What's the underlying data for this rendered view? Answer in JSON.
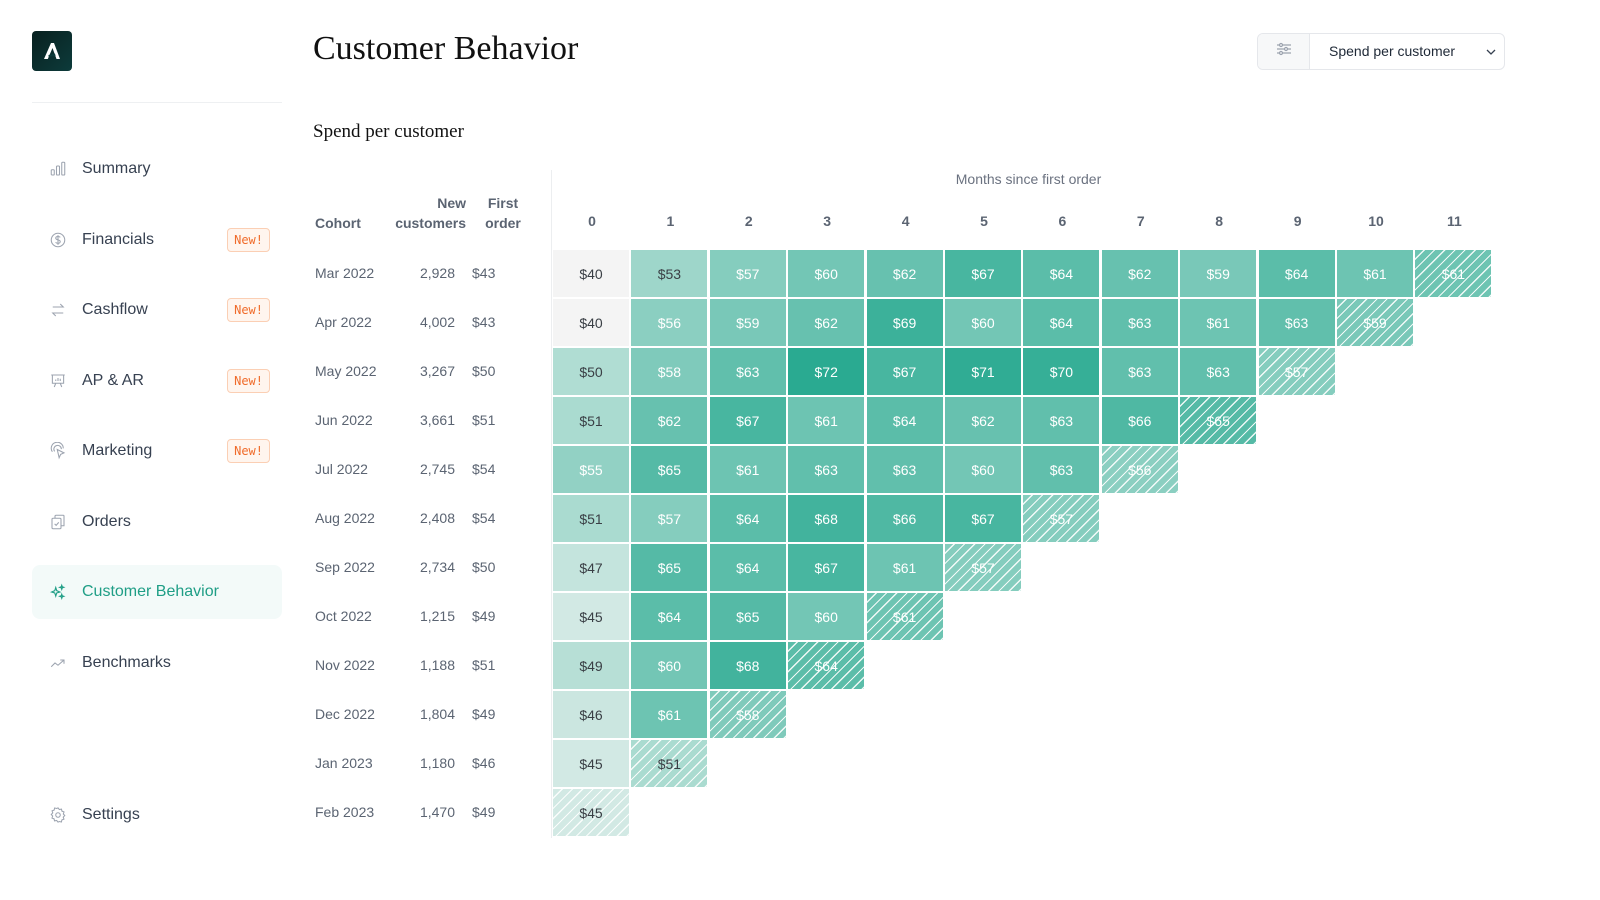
{
  "app": {
    "logo_letter": "A"
  },
  "sidebar": {
    "items": [
      {
        "label": "Summary",
        "icon": "bar-chart-icon",
        "badge": null,
        "active": false
      },
      {
        "label": "Financials",
        "icon": "dollar-circle-icon",
        "badge": "New!",
        "active": false
      },
      {
        "label": "Cashflow",
        "icon": "arrows-exchange-icon",
        "badge": "New!",
        "active": false
      },
      {
        "label": "AP & AR",
        "icon": "presentation-chart-icon",
        "badge": "New!",
        "active": false
      },
      {
        "label": "Marketing",
        "icon": "cursor-click-icon",
        "badge": "New!",
        "active": false
      },
      {
        "label": "Orders",
        "icon": "clipboard-check-icon",
        "badge": null,
        "active": false
      },
      {
        "label": "Customer Behavior",
        "icon": "sparkles-icon",
        "badge": null,
        "active": true
      },
      {
        "label": "Benchmarks",
        "icon": "trending-up-icon",
        "badge": null,
        "active": false
      }
    ],
    "settings": {
      "label": "Settings",
      "icon": "gear-icon"
    }
  },
  "header": {
    "title": "Customer Behavior",
    "metric_select": {
      "value": "Spend per customer",
      "icon": "sliders-icon"
    }
  },
  "colors": {
    "accent": "#1f9e86",
    "badge_text": "#f06b2a",
    "badge_bg": "#fff5ee"
  },
  "chart_data": {
    "type": "heatmap",
    "title": "Spend per customer",
    "xlabel": "Months since first order",
    "row_headers": {
      "cohort": "Cohort",
      "new_customers": "New customers",
      "first_order": "First order"
    },
    "columns": [
      "0",
      "1",
      "2",
      "3",
      "4",
      "5",
      "6",
      "7",
      "8",
      "9",
      "10",
      "11"
    ],
    "value_prefix": "$",
    "partial_last_cell": true,
    "rows": [
      {
        "cohort": "Mar 2022",
        "new_customers": "2,928",
        "first_order": "$43",
        "values": [
          40,
          53,
          57,
          60,
          62,
          67,
          64,
          62,
          59,
          64,
          61,
          61
        ]
      },
      {
        "cohort": "Apr 2022",
        "new_customers": "4,002",
        "first_order": "$43",
        "values": [
          40,
          56,
          59,
          62,
          69,
          60,
          64,
          63,
          61,
          63,
          59
        ]
      },
      {
        "cohort": "May 2022",
        "new_customers": "3,267",
        "first_order": "$50",
        "values": [
          50,
          58,
          63,
          72,
          67,
          71,
          70,
          63,
          63,
          57
        ]
      },
      {
        "cohort": "Jun 2022",
        "new_customers": "3,661",
        "first_order": "$51",
        "values": [
          51,
          62,
          67,
          61,
          64,
          62,
          63,
          66,
          65
        ]
      },
      {
        "cohort": "Jul 2022",
        "new_customers": "2,745",
        "first_order": "$54",
        "values": [
          55,
          65,
          61,
          63,
          63,
          60,
          63,
          56
        ]
      },
      {
        "cohort": "Aug 2022",
        "new_customers": "2,408",
        "first_order": "$54",
        "values": [
          51,
          57,
          64,
          68,
          66,
          67,
          57
        ]
      },
      {
        "cohort": "Sep 2022",
        "new_customers": "2,734",
        "first_order": "$50",
        "values": [
          47,
          65,
          64,
          67,
          61,
          57
        ]
      },
      {
        "cohort": "Oct 2022",
        "new_customers": "1,215",
        "first_order": "$49",
        "values": [
          45,
          64,
          65,
          60,
          61
        ]
      },
      {
        "cohort": "Nov 2022",
        "new_customers": "1,188",
        "first_order": "$51",
        "values": [
          49,
          60,
          68,
          64
        ]
      },
      {
        "cohort": "Dec 2022",
        "new_customers": "1,804",
        "first_order": "$49",
        "values": [
          46,
          61,
          58
        ]
      },
      {
        "cohort": "Jan 2023",
        "new_customers": "1,180",
        "first_order": "$46",
        "values": [
          45,
          51
        ]
      },
      {
        "cohort": "Feb 2023",
        "new_customers": "1,470",
        "first_order": "$49",
        "values": [
          45
        ]
      }
    ],
    "color_scale": {
      "min": 40,
      "max": 72,
      "low_color": "#f4f4f4",
      "mid_color": "#b0ddd3",
      "high_color": "#2aaa91"
    }
  }
}
